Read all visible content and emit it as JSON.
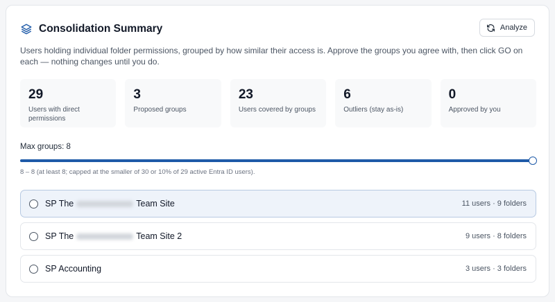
{
  "header": {
    "title": "Consolidation Summary",
    "analyze_label": "Analyze"
  },
  "description": "Users holding individual folder permissions, grouped by how similar their access is. Approve the groups you agree with, then click GO on each — nothing changes until you do.",
  "stats": [
    {
      "value": "29",
      "label": "Users with direct permissions"
    },
    {
      "value": "3",
      "label": "Proposed groups"
    },
    {
      "value": "23",
      "label": "Users covered by groups"
    },
    {
      "value": "6",
      "label": "Outliers (stay as-is)"
    },
    {
      "value": "0",
      "label": "Approved by you"
    }
  ],
  "slider": {
    "label": "Max groups: 8",
    "min": 8,
    "max": 8,
    "value": 8,
    "fill_fraction": 1.0,
    "hint": "8 – 8 (at least 8; capped at the smaller of 30 or 10% of 29 active Entra ID users)."
  },
  "groups": [
    {
      "prefix": "SP The",
      "suffix": "Team Site",
      "meta": "11 users · 9 folders"
    },
    {
      "prefix": "SP The",
      "suffix": "Team Site 2",
      "meta": "9 users · 8 folders"
    },
    {
      "prefix": "SP Accounting",
      "suffix": "",
      "meta": "3 users · 3 folders"
    }
  ],
  "icons": {
    "title": "layers-icon",
    "analyze": "refresh-icon",
    "radio": "radio-unchecked-icon"
  },
  "colors": {
    "accent": "#1e5aa8",
    "selected_bg": "#eef3fa"
  }
}
